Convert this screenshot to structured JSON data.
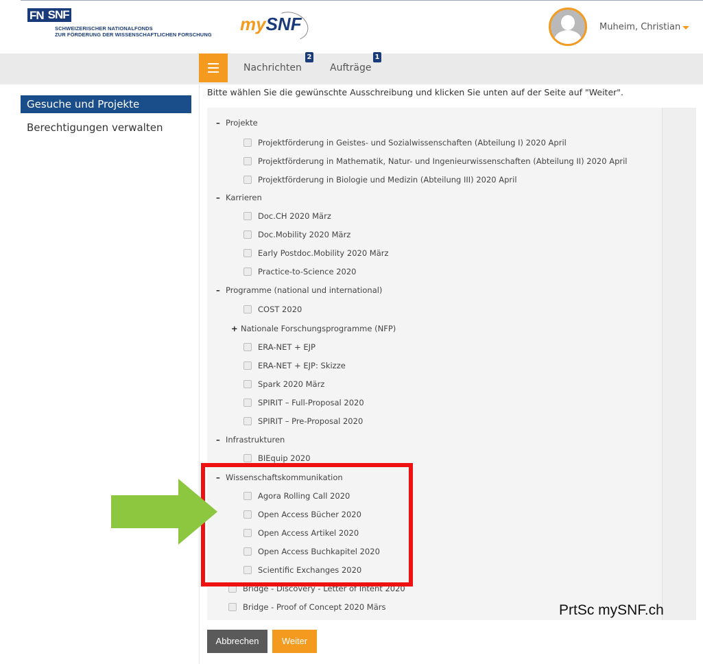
{
  "header": {
    "logo": {
      "fn": "FN",
      "snf": "SNF",
      "line1": "Schweizerischer Nationalfonds",
      "line2": "zur Förderung der wissenschaftlichen Forschung"
    },
    "app_logo": {
      "my": "my",
      "snf": "SNF"
    },
    "user": {
      "name": "Muheim, Christian"
    }
  },
  "nav": {
    "messages": {
      "label": "Nachrichten",
      "badge": "2"
    },
    "orders": {
      "label": "Aufträge",
      "badge": "1"
    }
  },
  "sidebar": {
    "items": [
      {
        "label": "Gesuche und Projekte"
      },
      {
        "label": "Berechtigungen verwalten"
      }
    ]
  },
  "main": {
    "instruction": "Bitte wählen Sie die gewünschte Ausschreibung und klicken Sie unten auf der Seite auf \"Weiter\".",
    "groups": {
      "projekte": {
        "label": "Projekte",
        "items": [
          "Projektförderung in Geistes- und Sozialwissenschaften (Abteilung I) 2020 April",
          "Projektförderung in Mathematik, Natur- und Ingenieurwissenschaften (Abteilung II) 2020 April",
          "Projektförderung in Biologie und Medizin (Abteilung III) 2020 April"
        ]
      },
      "karrieren": {
        "label": "Karrieren",
        "items": [
          "Doc.CH 2020 März",
          "Doc.Mobility 2020 März",
          "Early Postdoc.Mobility 2020 März",
          "Practice-to-Science 2020"
        ]
      },
      "programme": {
        "label": "Programme (national und international)",
        "items": [
          "COST 2020",
          "ERA-NET + EJP",
          "ERA-NET + EJP: Skizze",
          "Spark 2020 März",
          "SPIRIT – Full-Proposal 2020",
          "SPIRIT – Pre-Proposal 2020"
        ],
        "subgroup": "Nationale Forschungsprogramme (NFP)"
      },
      "infrastrukturen": {
        "label": "Infrastrukturen",
        "items": [
          "BIEquip 2020"
        ]
      },
      "wisskomm": {
        "label": "Wissenschaftskommunikation",
        "items": [
          "Agora Rolling Call 2020",
          "Open Access Bücher 2020",
          "Open Access Artikel 2020",
          "Open Access Buchkapitel 2020",
          "Scientific Exchanges 2020"
        ]
      },
      "bridge": {
        "items": [
          "Bridge - Discovery - Letter of Intent 2020",
          "Bridge - Proof of Concept 2020 Märs"
        ]
      }
    },
    "buttons": {
      "cancel": "Abbrechen",
      "next": "Weiter"
    }
  },
  "overlay": {
    "watermark": "PrtSc mySNF.ch"
  },
  "colors": {
    "accent": "#f39a1f",
    "brand": "#1a3b7a",
    "active": "#1a4e8a",
    "highlight": "#ee1111",
    "arrow": "#8dc63f"
  }
}
